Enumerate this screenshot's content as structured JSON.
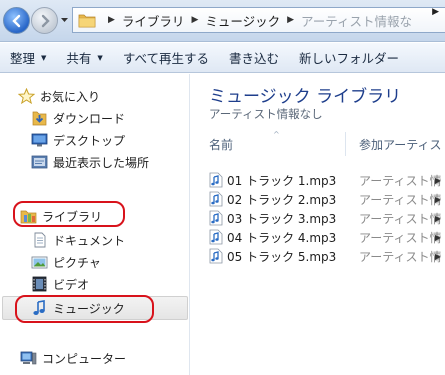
{
  "address_bar": {
    "crumbs": [
      "ライブラリ",
      "ミュージック"
    ],
    "faded_crumb": "アーティスト情報な"
  },
  "toolbar": {
    "organize": "整理",
    "share": "共有",
    "play_all": "すべて再生する",
    "burn": "書き込む",
    "new_folder": "新しいフォルダー"
  },
  "sidebar": {
    "favorites": "お気に入り",
    "downloads": "ダウンロード",
    "desktop": "デスクトップ",
    "recent": "最近表示した場所",
    "libraries": "ライブラリ",
    "documents": "ドキュメント",
    "pictures": "ピクチャ",
    "videos": "ビデオ",
    "music": "ミュージック",
    "computer": "コンピューター"
  },
  "main": {
    "title": "ミュージック ライブラリ",
    "subtitle": "アーティスト情報なし",
    "columns": {
      "name": "名前",
      "artist": "参加アーティス"
    },
    "files": [
      {
        "name": "01 トラック 1.mp3",
        "artist": "アーティスト情"
      },
      {
        "name": "02 トラック 2.mp3",
        "artist": "アーティスト情"
      },
      {
        "name": "03 トラック 3.mp3",
        "artist": "アーティスト情"
      },
      {
        "name": "04 トラック 4.mp3",
        "artist": "アーティスト情"
      },
      {
        "name": "05 トラック 5.mp3",
        "artist": "アーティスト情"
      }
    ]
  },
  "colors": {
    "annotation_red": "#d8121b",
    "title_blue": "#1e3e8c"
  }
}
